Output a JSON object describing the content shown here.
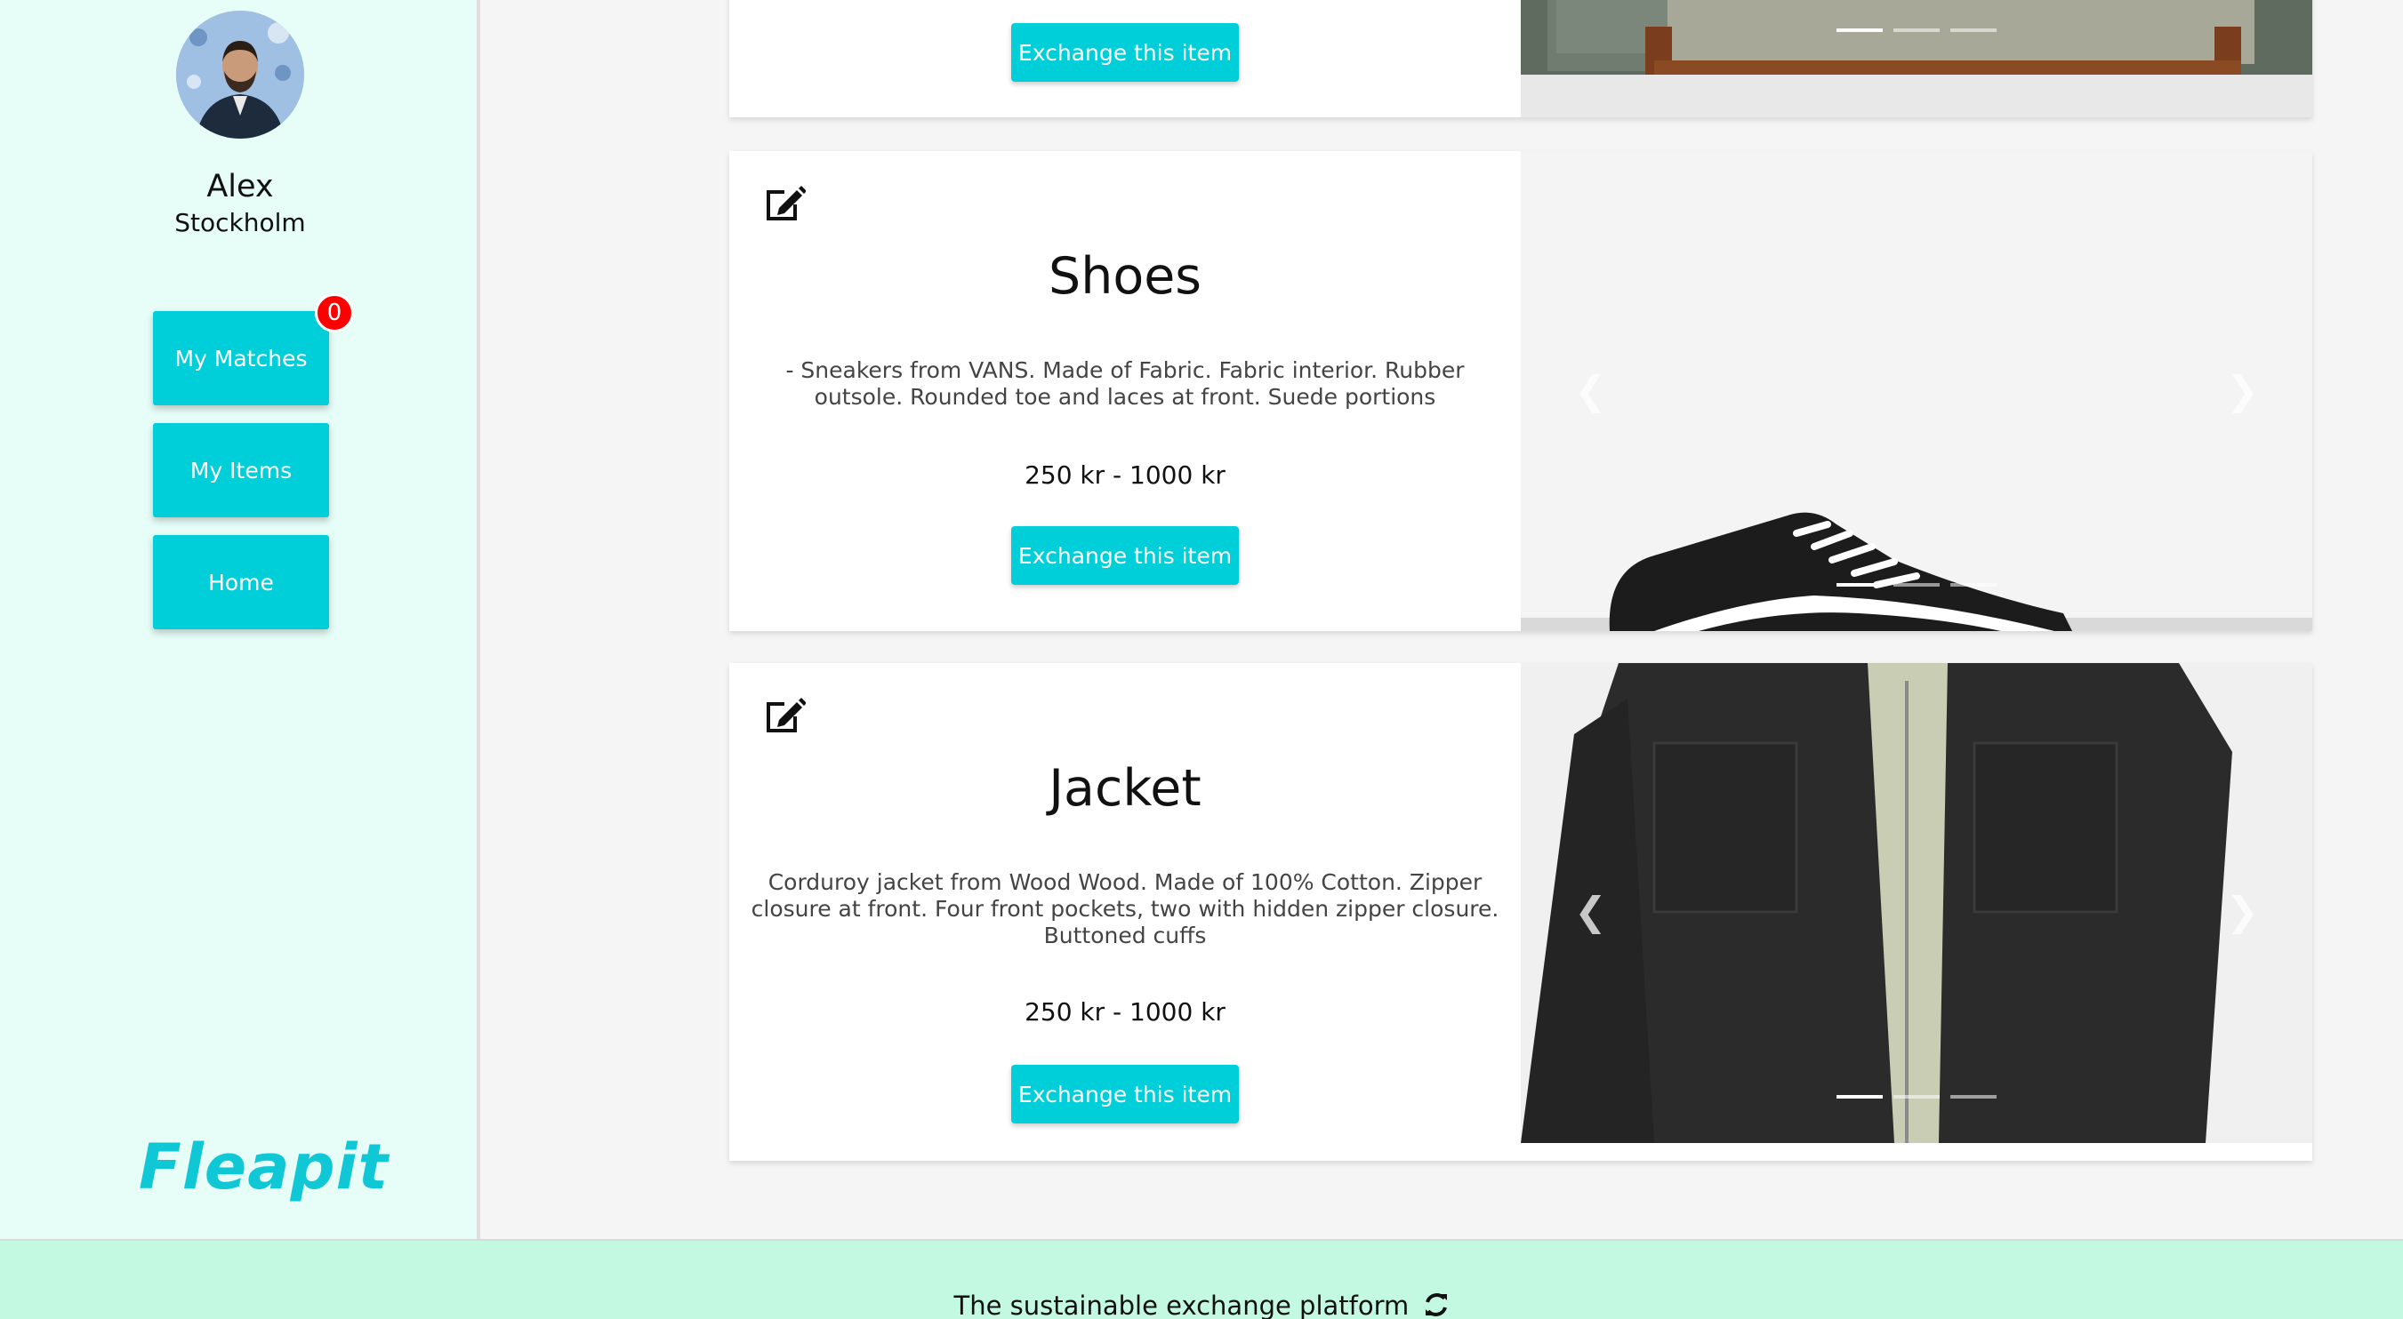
{
  "user": {
    "name": "Alex",
    "city": "Stockholm"
  },
  "nav": {
    "matches_label": "My Matches",
    "matches_count": "0",
    "items_label": "My Items",
    "home_label": "Home"
  },
  "brand": {
    "logo": "Fleapit",
    "accent_color": "#00cfd9"
  },
  "cards": [
    {
      "button_label": "Exchange this item"
    },
    {
      "title": "Shoes",
      "description": "- Sneakers from VANS. Made of Fabric. Fabric interior. Rubber outsole. Rounded toe and laces at front. Suede portions",
      "price": "250 kr - 1000 kr",
      "button_label": "Exchange this item"
    },
    {
      "title": "Jacket",
      "description": "Corduroy jacket from Wood Wood. Made of 100% Cotton. Zipper closure at front. Four front pockets, two with hidden zipper closure. Buttoned cuffs",
      "price": "250 kr - 1000 kr",
      "button_label": "Exchange this item"
    }
  ],
  "carousel": {
    "prev_icon": "chevron-left-icon",
    "next_icon": "chevron-right-icon",
    "indicator_count": 3,
    "active_indicator": 1
  },
  "footer": {
    "text": "The sustainable exchange platform",
    "icon": "refresh-icon"
  }
}
